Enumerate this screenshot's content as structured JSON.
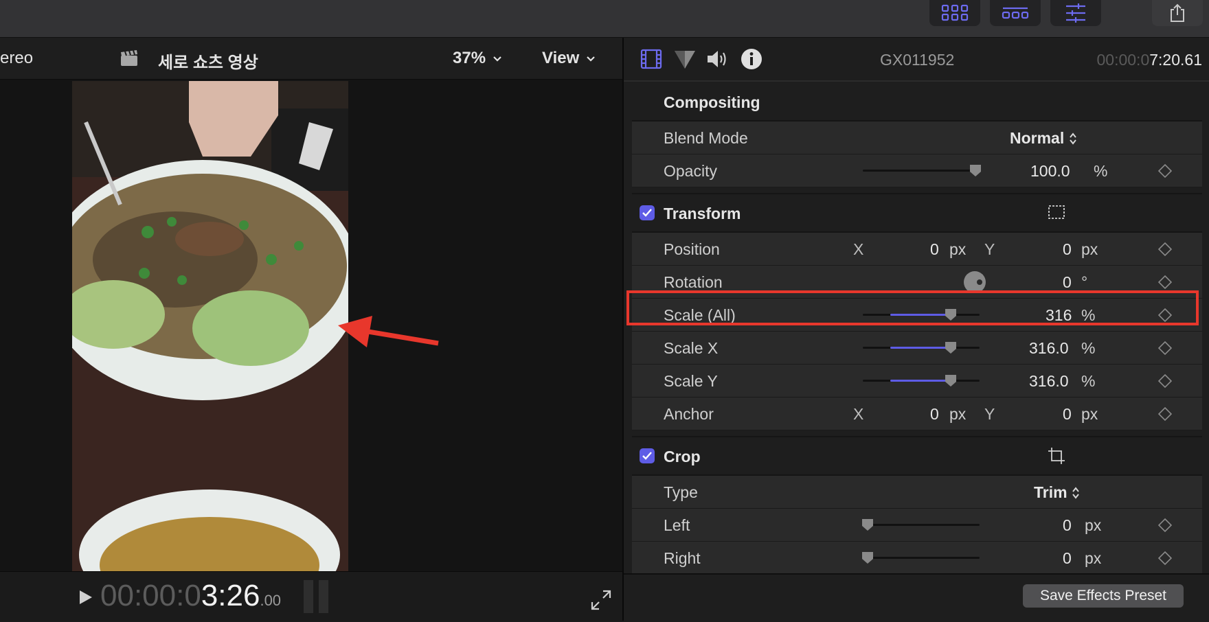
{
  "toolbar": {
    "buttons": [
      "browser-grid-icon",
      "timeline-icon",
      "inspector-sliders-icon",
      "share-icon"
    ]
  },
  "viewer": {
    "audio_mode": "ereo",
    "project_title": "세로 쇼츠 영상",
    "zoom": "37%",
    "view_label": "View",
    "timecode_dim": "00:00:0",
    "timecode_main": "3:26",
    "timecode_frames": ".00"
  },
  "inspector": {
    "tabs": [
      "video-inspector-icon",
      "color-inspector-icon",
      "audio-inspector-icon",
      "info-inspector-icon"
    ],
    "clip_name": "GX011952",
    "duration_dim": "00:00:0",
    "duration_main": "7:20.61",
    "compositing": {
      "title": "Compositing",
      "blend_mode_label": "Blend Mode",
      "blend_mode_value": "Normal",
      "opacity_label": "Opacity",
      "opacity_value": "100.0",
      "opacity_unit": "%",
      "opacity_level": 1.0
    },
    "transform": {
      "title": "Transform",
      "enabled": true,
      "position_label": "Position",
      "position_x": "0",
      "position_y": "0",
      "rotation_label": "Rotation",
      "rotation_value": "0",
      "rotation_unit": "°",
      "scale_all_label": "Scale (All)",
      "scale_all_value": "316",
      "scale_x_label": "Scale X",
      "scale_x_value": "316.0",
      "scale_y_label": "Scale Y",
      "scale_y_value": "316.0",
      "anchor_label": "Anchor",
      "anchor_x": "0",
      "anchor_y": "0",
      "x_axis": "X",
      "y_axis": "Y",
      "px_unit": "px",
      "pct_unit": "%"
    },
    "crop": {
      "title": "Crop",
      "enabled": true,
      "type_label": "Type",
      "type_value": "Trim",
      "left_label": "Left",
      "left_value": "0",
      "right_label": "Right",
      "right_value": "0",
      "px_unit": "px"
    },
    "save_preset_label": "Save Effects Preset"
  },
  "colors": {
    "accent": "#5e5ce6",
    "highlight": "#e8372c"
  }
}
